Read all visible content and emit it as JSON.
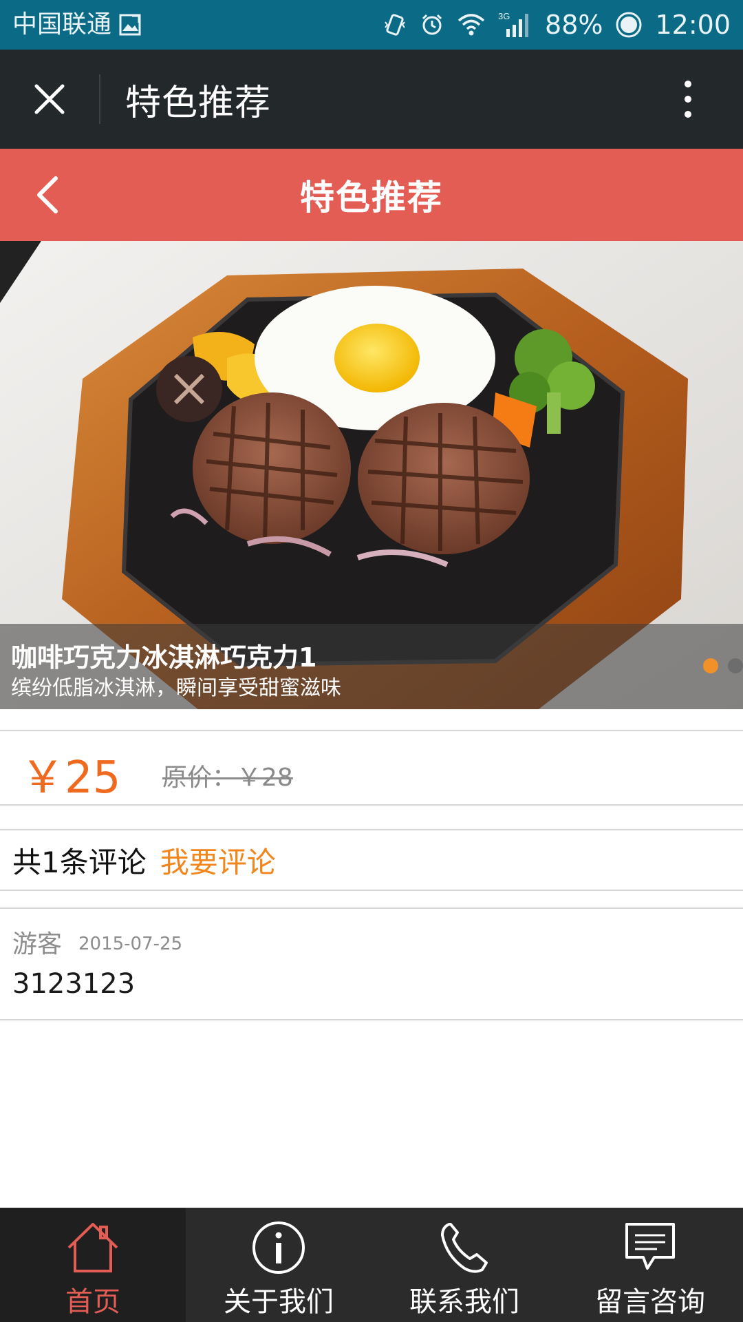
{
  "status_bar": {
    "carrier": "中国联通",
    "network": "3G",
    "battery": "88%",
    "time": "12:00",
    "icons": [
      "image-icon",
      "vibrate-icon",
      "alarm-icon",
      "wifi-icon",
      "signal-icon",
      "battery-icon"
    ]
  },
  "app_bar": {
    "title": "特色推荐",
    "close_icon": "close-icon",
    "more_icon": "more-vertical-icon"
  },
  "page_header": {
    "title": "特色推荐",
    "back_icon": "chevron-left-icon"
  },
  "carousel": {
    "title": "咖啡巧克力冰淇淋巧克力1",
    "subtitle": "缤纷低脂冰淇淋，瞬间享受甜蜜滋味",
    "slides_count": 2,
    "active_index": 0,
    "colors": {
      "active_dot": "#f2902a",
      "inactive_dot": "#6d6d6d"
    }
  },
  "price": {
    "current": "￥25",
    "original": "原价：￥28"
  },
  "comments": {
    "count_label": "共1条评论",
    "write_label": "我要评论",
    "items": [
      {
        "author": "游客",
        "date": "2015-07-25",
        "text": "3123123"
      }
    ]
  },
  "bottom_nav": {
    "items": [
      {
        "label": "首页",
        "icon": "home-icon",
        "active": true
      },
      {
        "label": "关于我们",
        "icon": "info-icon",
        "active": false
      },
      {
        "label": "联系我们",
        "icon": "phone-icon",
        "active": false
      },
      {
        "label": "留言咨询",
        "icon": "message-icon",
        "active": false
      }
    ]
  },
  "colors": {
    "status_bar": "#0b6b86",
    "app_bar": "#23292b",
    "accent_red": "#e45d55",
    "price_orange": "#ef6a1f",
    "link_orange": "#f0861c",
    "nav_bg": "#2b2b2b"
  }
}
